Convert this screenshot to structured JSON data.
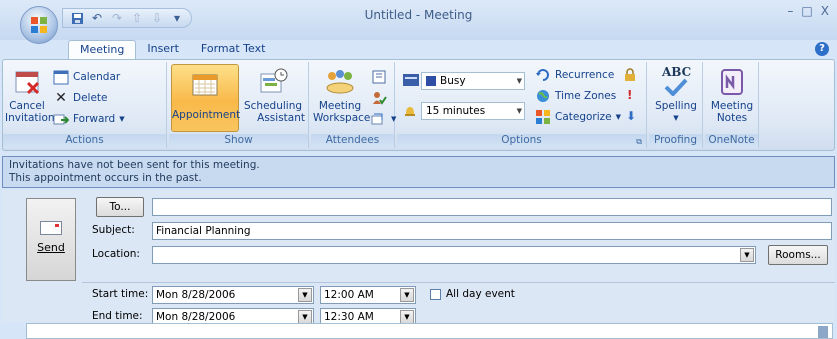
{
  "window": {
    "title": "Untitled - Meeting",
    "controls": [
      "–",
      "□",
      "X"
    ]
  },
  "qat": {
    "save": "save-icon",
    "undo": "undo-icon",
    "redo": "redo-icon",
    "up": "up-arrow-icon",
    "down": "down-arrow-icon",
    "customize": "▾"
  },
  "tabs": [
    {
      "label": "Meeting"
    },
    {
      "label": "Insert"
    },
    {
      "label": "Format Text"
    }
  ],
  "ribbon": {
    "actions": {
      "label": "Actions",
      "cancel_label_1": "Cancel",
      "cancel_label_2": "Invitation",
      "calendar": "Calendar",
      "delete": "Delete",
      "forward": "Forward"
    },
    "show": {
      "label": "Show",
      "appointment": "Appointment",
      "scheduling_1": "Scheduling",
      "scheduling_2": "Assistant"
    },
    "attendees": {
      "label": "Attendees",
      "workspace_1": "Meeting",
      "workspace_2": "Workspace"
    },
    "options": {
      "label": "Options",
      "show_as": "Busy",
      "reminder": "15 minutes",
      "recurrence": "Recurrence",
      "time_zones": "Time Zones",
      "categorize": "Categorize"
    },
    "proofing": {
      "label": "Proofing",
      "spelling": "Spelling",
      "abc": "ABC"
    },
    "onenote": {
      "label": "OneNote",
      "notes_1": "Meeting",
      "notes_2": "Notes"
    }
  },
  "infobar": {
    "line1": "Invitations have not been sent for this meeting.",
    "line2": "This appointment occurs in the past."
  },
  "form": {
    "send": "Send",
    "to_button": "To...",
    "to_value": "",
    "subject_label": "Subject:",
    "subject_value": "Financial Planning",
    "location_label": "Location:",
    "location_value": "",
    "rooms_button": "Rooms...",
    "start_label": "Start time:",
    "start_date": "Mon 8/28/2006",
    "start_time": "12:00 AM",
    "end_label": "End time:",
    "end_date": "Mon 8/28/2006",
    "end_time": "12:30 AM",
    "all_day_label": "All day event",
    "all_day_checked": false
  }
}
